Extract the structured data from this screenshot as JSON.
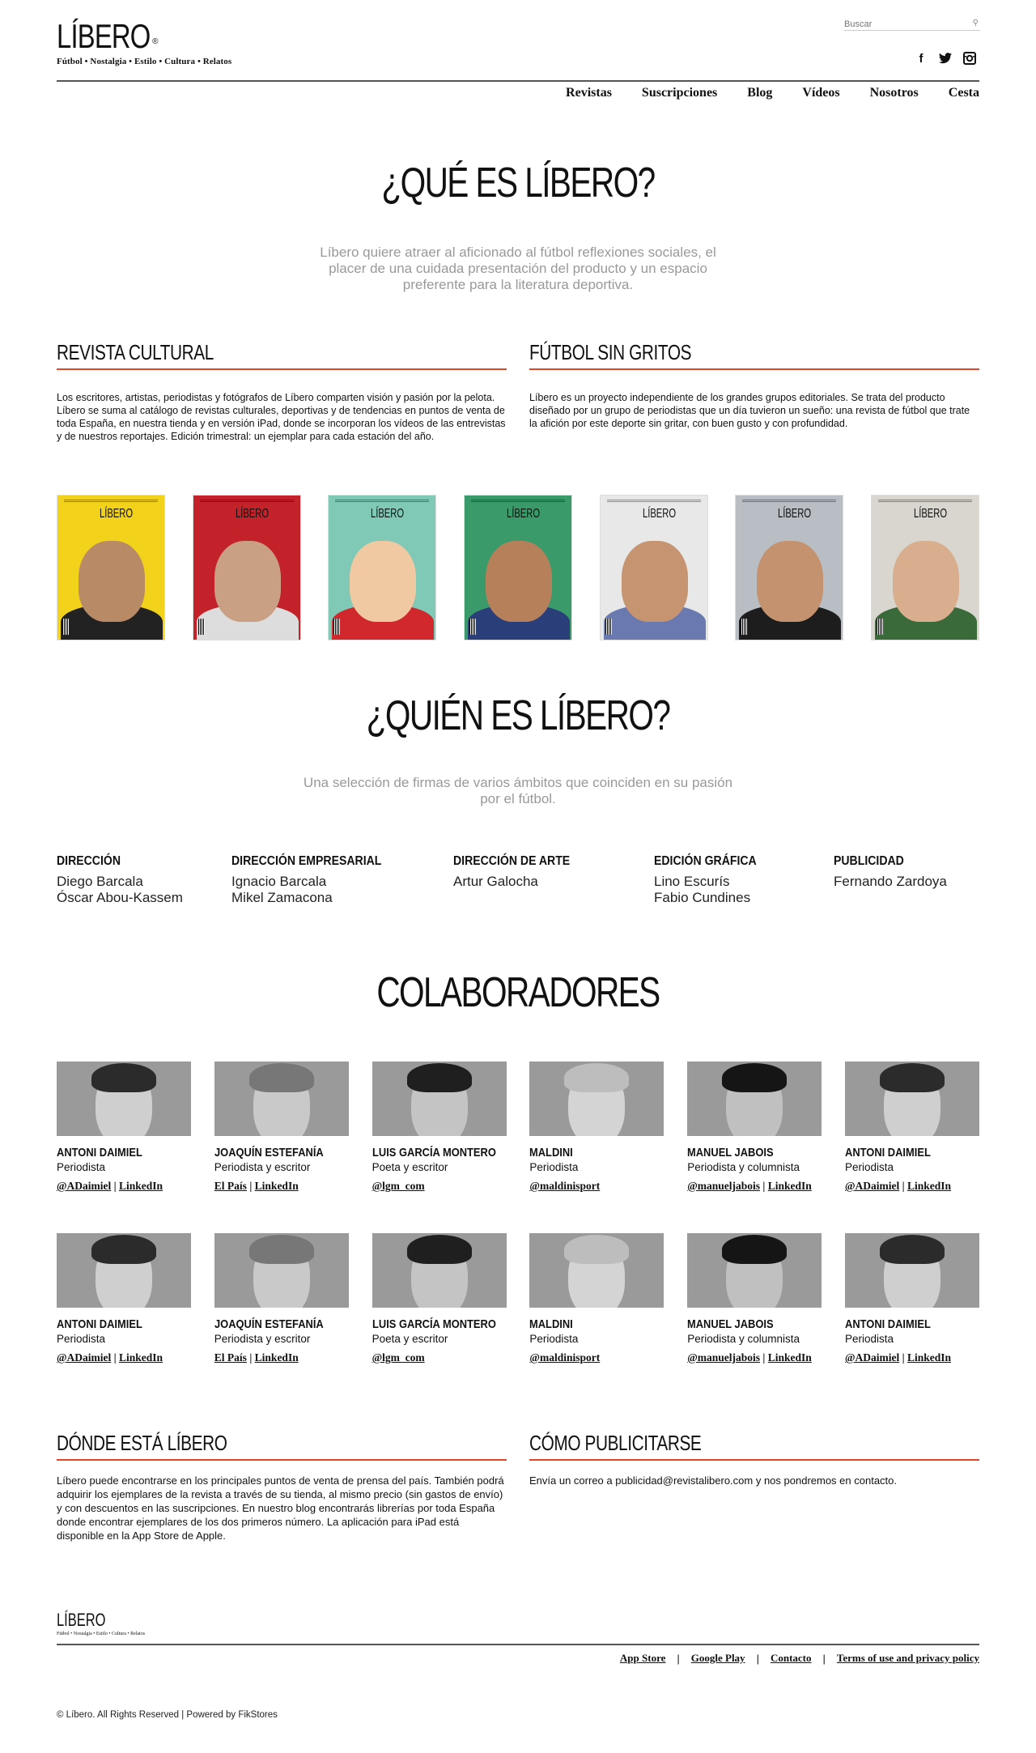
{
  "header": {
    "logo": "LÍBERO",
    "logo_reg": "®",
    "tagline": "Fútbol • Nostalgia • Estilo • Cultura • Relatos",
    "search_placeholder": "Buscar",
    "nav": [
      "Revistas",
      "Suscripciones",
      "Blog",
      "Vídeos",
      "Nosotros",
      "Cesta"
    ]
  },
  "que_es": {
    "title": "¿QUÉ ES LÍBERO?",
    "intro": "Líbero quiere atraer al aficionado al fútbol reflexiones sociales, el placer de una cuidada presentación del producto y un espacio preferente para la literatura deportiva."
  },
  "sections_top": [
    {
      "title": "REVISTA CULTURAL",
      "text": "Los escritores, artistas, periodistas y fotógrafos de Líbero comparten visión y pasión por la pelota. Líbero se suma al catálogo de revistas culturales, deportivas y de tendencias en puntos de venta de toda España, en nuestra tienda y en versión iPad, donde se incorporan los vídeos de las entrevistas y de nuestros reportajes. Edición trimestral: un ejemplar para cada estación del año."
    },
    {
      "title": "FÚTBOL SIN GRITOS",
      "text": "Líbero es un proyecto independiente de los grandes grupos editoriales. Se trata del producto diseñado por un grupo de periodistas que un día tuvieron un sueño: una revista de fútbol que trate la afición por este deporte sin gritar, con buen gusto y con profundidad."
    }
  ],
  "covers": [
    {
      "name": "LÍBERO",
      "bg": "#f2d21a",
      "face": "#b88a66",
      "body": "#222222"
    },
    {
      "name": "LÍBERO",
      "bg": "#c4222a",
      "face": "#caa084",
      "body": "#dddddd"
    },
    {
      "name": "LÍBERO",
      "bg": "#7fc9b6",
      "face": "#f0c9a2",
      "body": "#d0282c"
    },
    {
      "name": "LÍBERO",
      "bg": "#3a9a6a",
      "face": "#b5805a",
      "body": "#2a3f7a"
    },
    {
      "name": "LÍBERO",
      "bg": "#e8e8e8",
      "face": "#c69470",
      "body": "#6a7ab0"
    },
    {
      "name": "LÍBERO",
      "bg": "#b8bec4",
      "face": "#c4926e",
      "body": "#1d1d1d"
    },
    {
      "name": "LÍBERO",
      "bg": "#d8d6cf",
      "face": "#d9ae8e",
      "body": "#3a6a3a"
    }
  ],
  "quien_es": {
    "title": "¿QUIÉN ES LÍBERO?",
    "intro": "Una selección de firmas de varios ámbitos que coinciden en su pasión por el fútbol."
  },
  "team": [
    {
      "role": "DIRECCIÓN",
      "names": [
        "Diego Barcala",
        "Óscar Abou-Kassem"
      ]
    },
    {
      "role": "DIRECCIÓN EMPRESARIAL",
      "names": [
        "Ignacio Barcala",
        "Mikel Zamacona"
      ]
    },
    {
      "role": "DIRECCIÓN DE ARTE",
      "names": [
        "Artur Galocha"
      ]
    },
    {
      "role": "EDICIÓN GRÁFICA",
      "names": [
        "Lino Escurís",
        "Fabio Cundines"
      ]
    },
    {
      "role": "PUBLICIDAD",
      "names": [
        "Fernando Zardoya"
      ]
    }
  ],
  "colaboradores": {
    "title": "COLABORADORES",
    "people": [
      {
        "name": "ANTONI DAIMIEL",
        "role": "Periodista",
        "links": [
          "@ADaimiel",
          "LinkedIn"
        ]
      },
      {
        "name": "JOAQUÍN ESTEFANÍA",
        "role": "Periodista y escritor",
        "links": [
          "El País",
          "LinkedIn"
        ]
      },
      {
        "name": "LUIS GARCÍA MONTERO",
        "role": "Poeta y escritor",
        "links": [
          "@lgm_com"
        ]
      },
      {
        "name": "MALDINI",
        "role": "Periodista",
        "links": [
          "@maldinisport"
        ]
      },
      {
        "name": "MANUEL JABOIS",
        "role": "Periodista y columnista",
        "links": [
          "@manueljabois",
          "LinkedIn"
        ]
      },
      {
        "name": "ANTONI DAIMIEL",
        "role": "Periodista",
        "links": [
          "@ADaimiel",
          "LinkedIn"
        ]
      },
      {
        "name": "ANTONI DAIMIEL",
        "role": "Periodista",
        "links": [
          "@ADaimiel",
          "LinkedIn"
        ]
      },
      {
        "name": "JOAQUÍN ESTEFANÍA",
        "role": "Periodista y escritor",
        "links": [
          "El País",
          "LinkedIn"
        ]
      },
      {
        "name": "LUIS GARCÍA MONTERO",
        "role": "Poeta y escritor",
        "links": [
          "@lgm_com"
        ]
      },
      {
        "name": "MALDINI",
        "role": "Periodista",
        "links": [
          "@maldinisport"
        ]
      },
      {
        "name": "MANUEL JABOIS",
        "role": "Periodista y columnista",
        "links": [
          "@manueljabois",
          "LinkedIn"
        ]
      },
      {
        "name": "ANTONI DAIMIEL",
        "role": "Periodista",
        "links": [
          "@ADaimiel",
          "LinkedIn"
        ]
      }
    ]
  },
  "sections_bottom": [
    {
      "title": "DÓNDE ESTÁ LÍBERO",
      "text": "Líbero puede encontrarse en los principales puntos de venta de prensa del país. También podrá adquirir los ejemplares de la revista a través de su tienda, al mismo precio (sin gastos de envío) y con descuentos en las suscripciones. En nuestro blog encontrarás librerías por toda España donde encontrar ejemplares de los dos primeros número. La aplicación para iPad está disponible en la App Store de Apple."
    },
    {
      "title": "CÓMO PUBLICITARSE",
      "text": "Envía un correo a publicidad@revistalibero.com y nos pondremos en contacto."
    }
  ],
  "footer": {
    "logo": "LÍBERO",
    "tagline": "Fútbol • Nostalgia • Estilo • Cultura • Relatos",
    "links": [
      "App Store",
      "Google Play",
      "Contacto",
      "Terms of use and privacy policy"
    ],
    "separator": "|",
    "copyright": "© Líbero. All Rights Reserved | Powered by FikStores"
  },
  "colors": {
    "accent": "#e2472a",
    "text": "#111111",
    "muted": "#999999",
    "photo_bg": "#9a9a9a"
  }
}
